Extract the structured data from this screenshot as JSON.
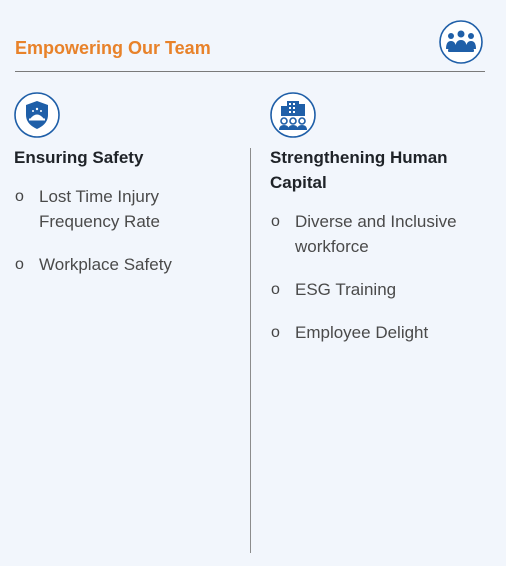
{
  "header": {
    "title": "Empowering Our Team",
    "icon": "team-icon",
    "accent_color": "#e8822a",
    "icon_color": "#1f5fa8"
  },
  "columns": [
    {
      "icon": "safety-shield-icon",
      "title": "Ensuring Safety",
      "bullet_marker": "o",
      "items": [
        "Lost Time Injury Frequency Rate",
        "Workplace Safety"
      ]
    },
    {
      "icon": "human-capital-icon",
      "title": "Strengthening Human Capital",
      "bullet_marker": "o",
      "items": [
        "Diverse and Inclusive workforce",
        "ESG Training",
        "Employee Delight"
      ]
    }
  ]
}
